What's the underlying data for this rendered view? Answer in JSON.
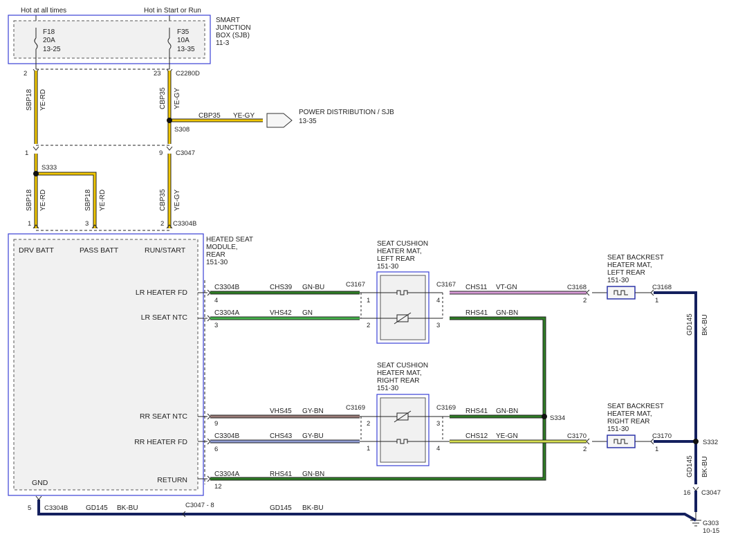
{
  "power": {
    "hot_at_all_times": "Hot at all times",
    "hot_in_start_or_run": "Hot in Start or Run"
  },
  "sjb": {
    "title_lines": [
      "SMART",
      "JUNCTION",
      "BOX (SJB)",
      "11-3"
    ],
    "fuse_f18": [
      "F18",
      "20A",
      "13-25"
    ],
    "fuse_f35": [
      "F35",
      "10A",
      "13-35"
    ],
    "pin_left": "2",
    "pin_right": "23",
    "connector": "C2280D"
  },
  "wires": {
    "sbp18": "SBP18",
    "ye_rd": "YE-RD",
    "cbp35": "CBP35",
    "ye_gy": "YE-GY",
    "splice_s308": "S308",
    "splice_s333": "S333",
    "c3047": "C3047",
    "pin_1": "1",
    "pin_9": "9",
    "pin_3": "3",
    "pin_2": "2"
  },
  "power_dist": {
    "lines": [
      "POWER DISTRIBUTION / SJB",
      "13-35"
    ]
  },
  "module": {
    "title_lines": [
      "HEATED SEAT",
      "MODULE,",
      "REAR",
      "151-30"
    ],
    "connector": "C3304B",
    "drv_batt": "DRV BATT",
    "pass_batt": "PASS BATT",
    "run_start": "RUN/START",
    "lr_heater_fd": "LR HEATER FD",
    "lr_seat_ntc": "LR SEAT NTC",
    "rr_seat_ntc": "RR SEAT NTC",
    "rr_heater_fd": "RR HEATER FD",
    "return": "RETURN",
    "gnd": "GND"
  },
  "circuits": {
    "row1": {
      "conn": "C3304B",
      "pin": "4",
      "circuit": "CHS39",
      "color": "GN-BU"
    },
    "row2": {
      "conn": "C3304A",
      "pin": "3",
      "circuit": "VHS42",
      "color": "GN"
    },
    "row3": {
      "pin": "9",
      "circuit": "VHS45",
      "color": "GY-BN"
    },
    "row4": {
      "conn": "C3304B",
      "pin": "6",
      "circuit": "CHS43",
      "color": "GY-BU"
    },
    "row5": {
      "conn": "C3304A",
      "pin": "12",
      "circuit": "RHS41",
      "color": "GN-BN"
    }
  },
  "mat_left": {
    "title_lines": [
      "SEAT CUSHION",
      "HEATER MAT,",
      "LEFT REAR",
      "151-30"
    ],
    "connector": "C3167",
    "pin_a1": "1",
    "pin_a2": "2",
    "pin_b4": "4",
    "pin_b3": "3"
  },
  "mat_right": {
    "title_lines": [
      "SEAT CUSHION",
      "HEATER MAT,",
      "RIGHT REAR",
      "151-30"
    ],
    "connector": "C3169",
    "pin_a2": "2",
    "pin_a1": "1",
    "pin_b3": "3",
    "pin_b4": "4"
  },
  "right_side": {
    "chs11": "CHS11",
    "vt_gn": "VT-GN",
    "rhs41": "RHS41",
    "gn_bn": "GN-BN",
    "chs12": "CHS12",
    "ye_gn": "YE-GN",
    "c3168": "C3168",
    "c3170": "C3170",
    "pin_2": "2",
    "pin_1": "1",
    "s334": "S334",
    "s332": "S332",
    "gd145": "GD145",
    "bk_bu": "BK-BU",
    "c3047": "C3047",
    "pin_16": "16",
    "g303": "G303",
    "g303_ref": "10-15"
  },
  "backrest_left": {
    "title_lines": [
      "SEAT BACKREST",
      "HEATER MAT,",
      "LEFT REAR",
      "151-30"
    ]
  },
  "backrest_right": {
    "title_lines": [
      "SEAT BACKREST",
      "HEATER MAT,",
      "RIGHT REAR",
      "151-30"
    ]
  },
  "ground": {
    "pin_5": "5",
    "c3304b": "C3304B",
    "gd145": "GD145",
    "bk_bu": "BK-BU",
    "c3047_8": "C3047 - 8"
  },
  "colors": {
    "yellow": "#f2c800",
    "dark_green": "#2f7d25",
    "light_green": "#44b34a",
    "violet": "#d79ad6",
    "gray_brown": "#9a7c78",
    "gray_blue": "#8f9bd2",
    "yellow_green": "#d8e050",
    "navy": "#14205e",
    "box_blue": "#3a3fd6"
  }
}
